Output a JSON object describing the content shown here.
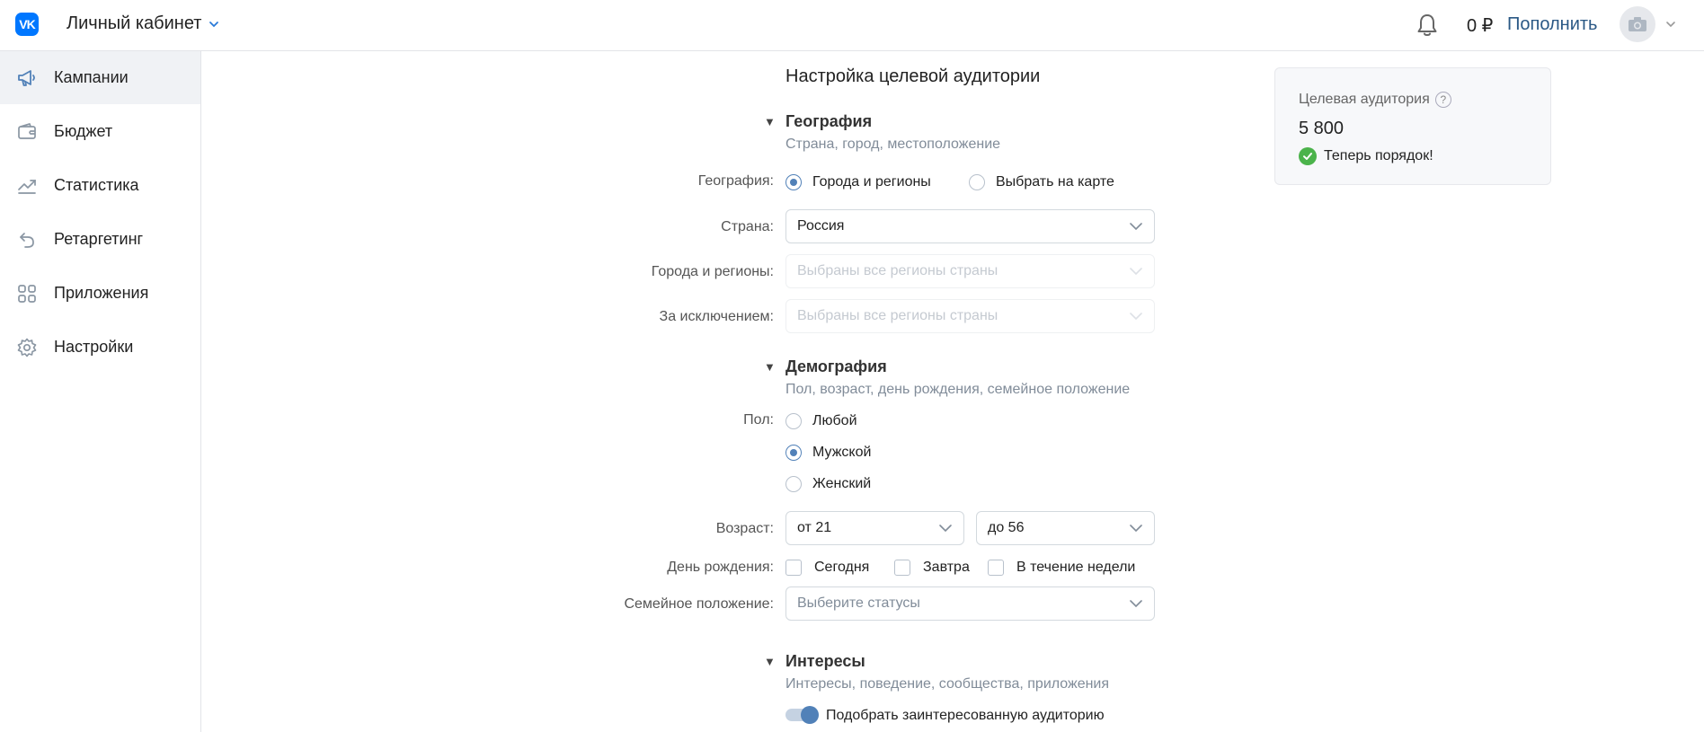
{
  "header": {
    "logo_text": "VK",
    "cabinet_label": "Личный кабинет",
    "balance": "0 ₽",
    "topup_label": "Пополнить"
  },
  "sidebar": {
    "items": [
      {
        "label": "Кампании",
        "icon": "megaphone-icon",
        "active": true
      },
      {
        "label": "Бюджет",
        "icon": "wallet-icon",
        "active": false
      },
      {
        "label": "Статистика",
        "icon": "chart-line-icon",
        "active": false
      },
      {
        "label": "Ретаргетинг",
        "icon": "retarget-arrow-icon",
        "active": false
      },
      {
        "label": "Приложения",
        "icon": "apps-grid-icon",
        "active": false
      },
      {
        "label": "Настройки",
        "icon": "gear-icon",
        "active": false
      }
    ]
  },
  "form": {
    "title": "Настройка целевой аудитории",
    "geography": {
      "title": "География",
      "subtitle": "Страна, город, местоположение",
      "label_geo": "География:",
      "option_cities": "Города и регионы",
      "option_map": "Выбрать на карте",
      "label_country": "Страна:",
      "country_value": "Россия",
      "label_cities": "Города и регионы:",
      "cities_placeholder": "Выбраны все регионы страны",
      "label_except": "За исключением:",
      "except_placeholder": "Выбраны все регионы страны"
    },
    "demography": {
      "title": "Демография",
      "subtitle": "Пол, возраст, день рождения, семейное положение",
      "label_gender": "Пол:",
      "gender_any": "Любой",
      "gender_male": "Мужской",
      "gender_female": "Женский",
      "label_age": "Возраст:",
      "age_from": "от 21",
      "age_to": "до 56",
      "label_birthday": "День рождения:",
      "bday_today": "Сегодня",
      "bday_tomorrow": "Завтра",
      "bday_week": "В течение недели",
      "label_family": "Семейное положение:",
      "family_placeholder": "Выберите статусы"
    },
    "interests": {
      "title": "Интересы",
      "subtitle": "Интересы, поведение, сообщества, приложения",
      "toggle_label": "Подобрать заинтересованную аудиторию"
    }
  },
  "audience": {
    "title": "Целевая аудитория",
    "help": "?",
    "count": "5 800",
    "status": "Теперь порядок!"
  },
  "colors": {
    "accent": "#5181b8",
    "link": "#2a5885",
    "ok": "#4bb34b",
    "vk_blue": "#0077ff"
  }
}
